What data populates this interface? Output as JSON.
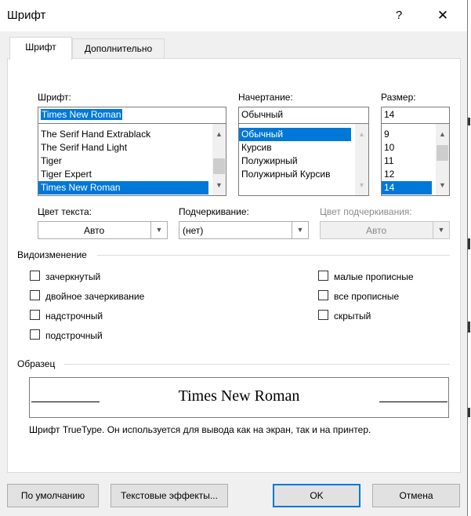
{
  "window": {
    "title": "Шрифт",
    "help": "?",
    "close": "✕"
  },
  "tabs": [
    {
      "label": "Шрифт"
    },
    {
      "label": "Дополнительно"
    }
  ],
  "font": {
    "label": "Шрифт:",
    "value": "Times New Roman",
    "list": [
      "The Serif Hand Extrablack",
      "The Serif Hand Light",
      "Tiger",
      "Tiger Expert",
      "Times New Roman"
    ],
    "selected_index": 4
  },
  "style": {
    "label": "Начертание:",
    "value": "Обычный",
    "list": [
      "Обычный",
      "Курсив",
      "Полужирный",
      "Полужирный Курсив"
    ],
    "selected_index": 0
  },
  "size": {
    "label": "Размер:",
    "value": "14",
    "list": [
      "9",
      "10",
      "11",
      "12",
      "14"
    ],
    "selected_index": 4
  },
  "font_color": {
    "label": "Цвет текста:",
    "value": "Авто"
  },
  "underline": {
    "label": "Подчеркивание:",
    "value": "(нет)"
  },
  "underline_color": {
    "label": "Цвет подчеркивания:",
    "value": "Авто"
  },
  "effects": {
    "heading": "Видоизменение",
    "left": [
      "зачеркнутый",
      "двойное зачеркивание",
      "надстрочный",
      "подстрочный"
    ],
    "right": [
      "малые прописные",
      "все прописные",
      "скрытый"
    ]
  },
  "preview": {
    "heading": "Образец",
    "text": "Times New Roman",
    "note": "Шрифт TrueType. Он используется для вывода как на экран, так и на принтер."
  },
  "buttons": {
    "default": "По умолчанию",
    "text_effects": "Текстовые эффекты...",
    "ok": "OK",
    "cancel": "Отмена"
  },
  "colors": {
    "selection": "#0078d7",
    "dialog_bg": "#f0f0f0"
  }
}
